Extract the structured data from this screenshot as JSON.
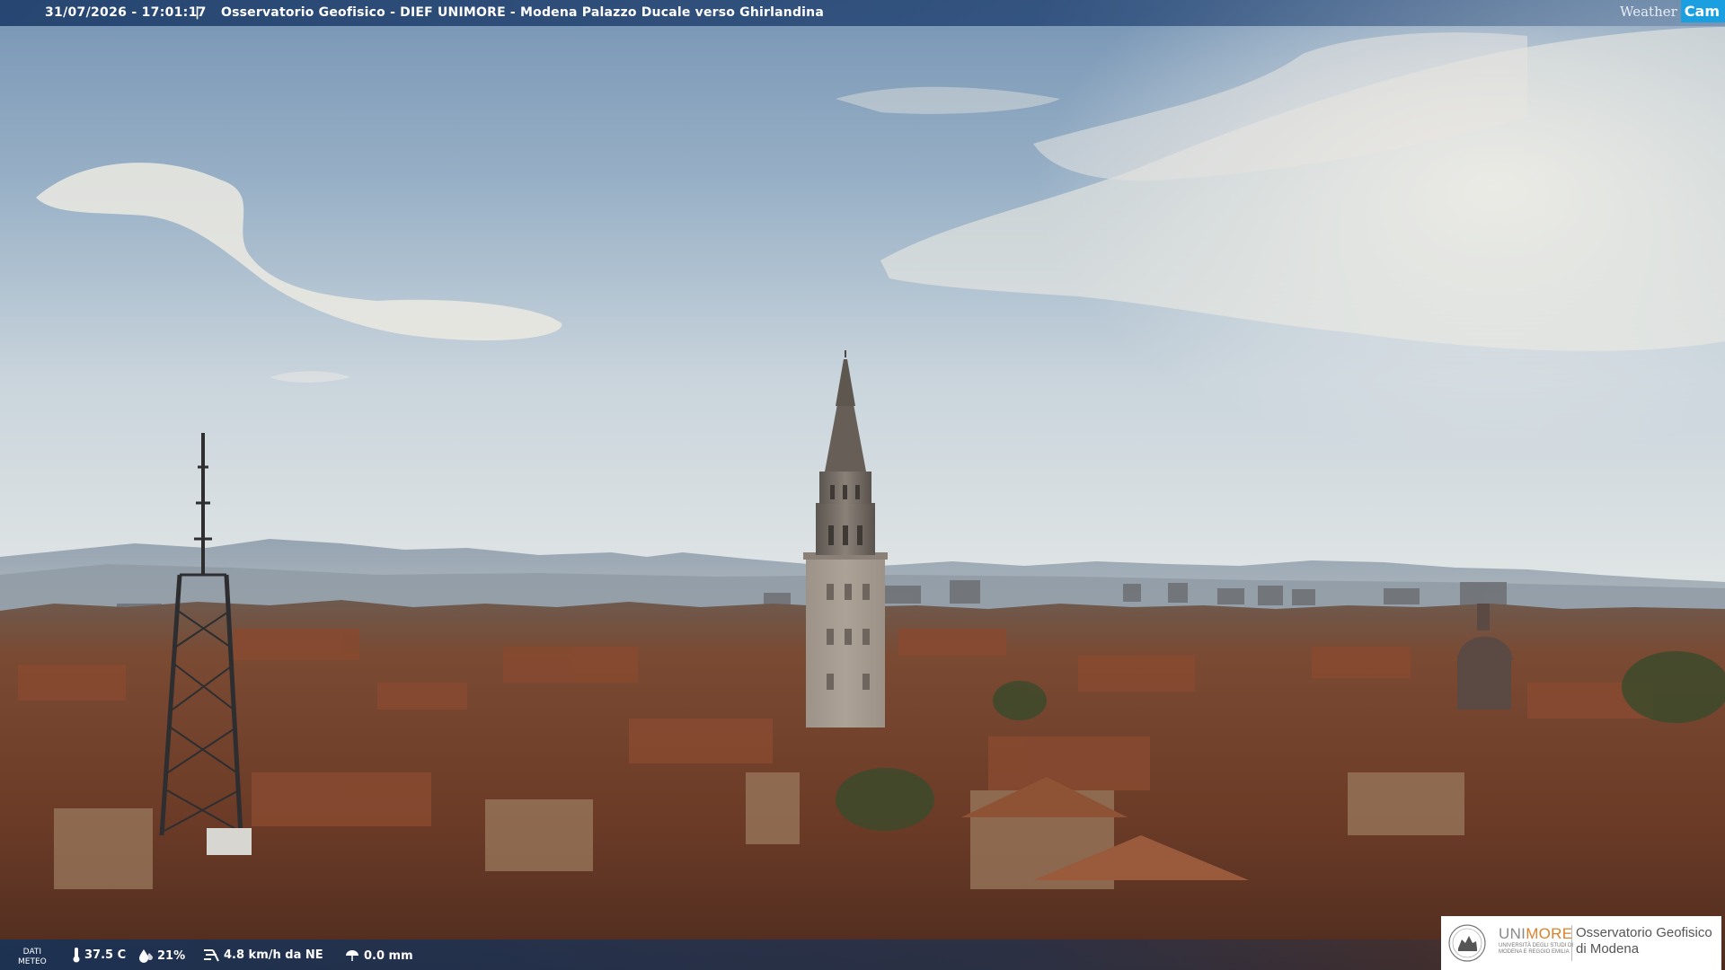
{
  "header": {
    "datetime": "31/07/2026 - 17:01:17",
    "separator": "|",
    "title": "Osservatorio Geofisico - DIEF UNIMORE - Modena Palazzo Ducale verso Ghirlandina",
    "brand_weather": "Weather",
    "brand_cam": "Cam"
  },
  "weather": {
    "label_line1": "DATI",
    "label_line2": "METEO",
    "temperature": "37.5 C",
    "humidity": "21%",
    "wind": "4.8 km/h da NE",
    "rain": "0.0 mm",
    "icons": [
      "thermometer-icon",
      "humidity-drop-icon",
      "wind-icon",
      "rain-umbrella-icon"
    ]
  },
  "logo": {
    "uni_part1": "UNI",
    "uni_part2": "MORE",
    "uni_sub1": "UNIVERSITÀ DEGLI STUDI DI",
    "uni_sub2": "MODENA E REGGIO EMILIA",
    "obs_line1": "Osservatorio Geofisico",
    "obs_line2": "di Modena"
  },
  "colors": {
    "sky_top": "#7f9dbb",
    "sky_horizon": "#dfe5e7",
    "roofs": "#6a3e2a",
    "accent_cam": "#1aa0e0",
    "unimore_orange": "#d9822b"
  }
}
